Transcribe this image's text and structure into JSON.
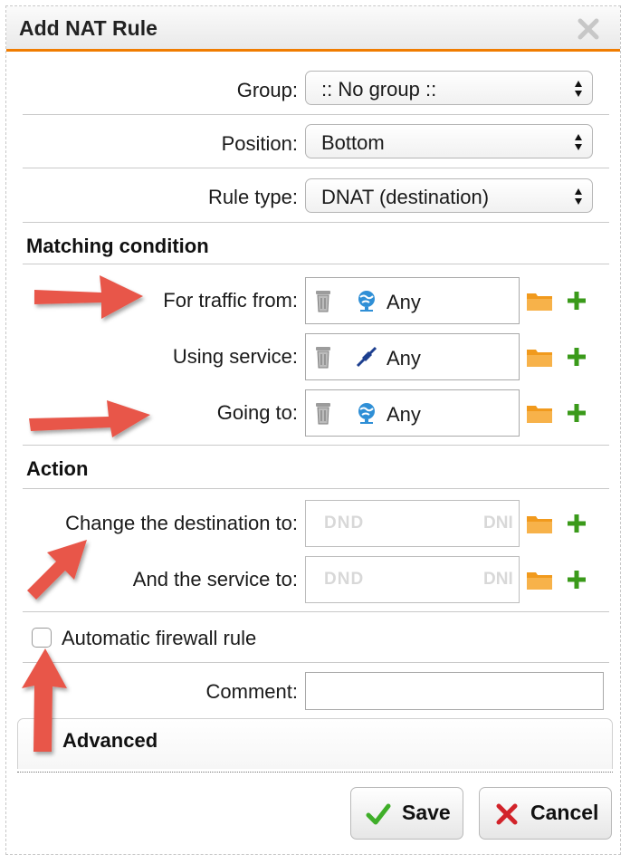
{
  "dialog": {
    "title": "Add NAT Rule",
    "close_icon": "close-x-icon"
  },
  "general": {
    "group_label": "Group:",
    "group_value": ":: No group ::",
    "position_label": "Position:",
    "position_value": "Bottom",
    "rule_type_label": "Rule type:",
    "rule_type_value": "DNAT (destination)"
  },
  "matching": {
    "heading": "Matching condition",
    "traffic_from": {
      "label": "For traffic from:",
      "value": "Any",
      "icon": "network-globe-icon"
    },
    "service": {
      "label": "Using service:",
      "value": "Any",
      "icon": "service-plug-icon"
    },
    "going_to": {
      "label": "Going to:",
      "value": "Any",
      "icon": "network-globe-icon"
    }
  },
  "action": {
    "heading": "Action",
    "destination": {
      "label": "Change the destination to:",
      "placeholder_left": "DND",
      "placeholder_right": "DNI"
    },
    "service": {
      "label": "And the service to:",
      "placeholder_left": "DND",
      "placeholder_right": "DNI"
    }
  },
  "options": {
    "auto_firewall_label": "Automatic firewall rule",
    "auto_firewall_checked": false,
    "comment_label": "Comment:",
    "comment_value": ""
  },
  "advanced": {
    "label": "Advanced"
  },
  "buttons": {
    "save": "Save",
    "cancel": "Cancel"
  },
  "colors": {
    "accent_orange": "#f07c00",
    "plus_green": "#3a9a1a",
    "save_check_green": "#3fae29",
    "cancel_x_red": "#d2232a",
    "annotation_arrow_red": "#e8564a"
  }
}
